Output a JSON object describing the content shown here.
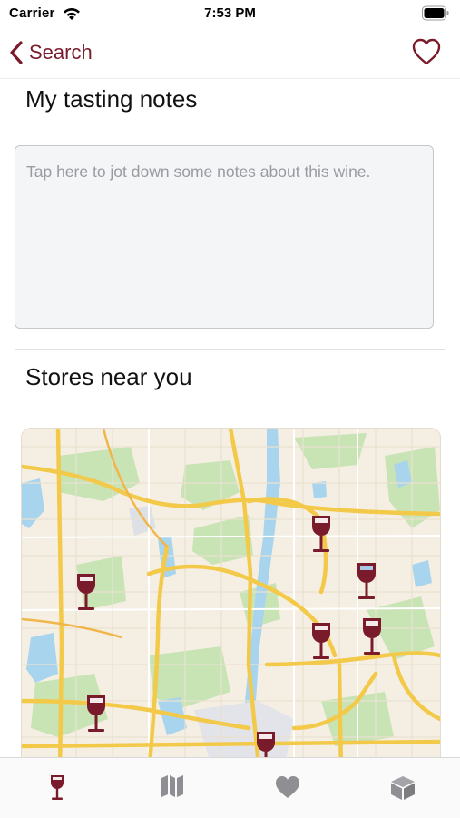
{
  "status_bar": {
    "carrier": "Carrier",
    "time": "7:53 PM",
    "icons": [
      "wifi-icon",
      "battery-icon"
    ]
  },
  "nav": {
    "back_label": "Search",
    "back_icon": "chevron-left-icon",
    "favorite_icon": "heart-outline-icon"
  },
  "notes": {
    "title": "My tasting notes",
    "placeholder": "Tap here to jot down some notes about this wine."
  },
  "stores": {
    "title": "Stores near you",
    "map_pin_icon": "wine-glass-pin-icon",
    "pin_count": 7
  },
  "tab_bar": {
    "tabs": [
      {
        "icon": "wine-glass-icon",
        "selected": true
      },
      {
        "icon": "map-icon",
        "selected": false
      },
      {
        "icon": "heart-icon",
        "selected": false
      },
      {
        "icon": "box-icon",
        "selected": false
      }
    ]
  },
  "colors": {
    "accent": "#7a1b2b",
    "tab_inactive": "#8e8e93",
    "map_land": "#f5efe3",
    "map_water": "#a8d4ee",
    "map_park": "#c8e3b4",
    "map_highway": "#f3c94a"
  }
}
